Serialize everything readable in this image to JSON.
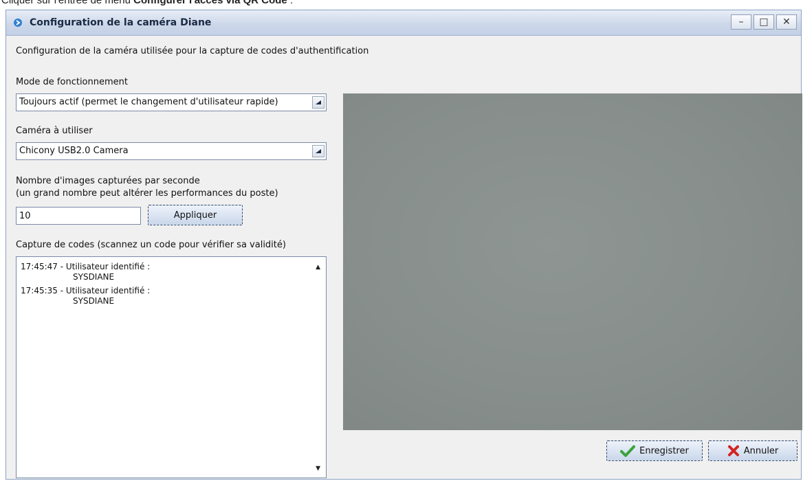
{
  "doc": {
    "line_prefix": "Cliquer sur l'entrée de menu ",
    "line_bold": "Configurer l'accès via QR Code",
    "line_suffix": " :"
  },
  "window": {
    "title": "Configuration de la caméra Diane",
    "controls": {
      "minimize": "–",
      "maximize": "□",
      "close": "✕"
    }
  },
  "description": "Configuration de la caméra utilisée pour la capture de codes d'authentification",
  "mode": {
    "label": "Mode de fonctionnement",
    "value": "Toujours actif (permet le changement d'utilisateur rapide)"
  },
  "camera_select": {
    "label": "Caméra à utiliser",
    "value": "Chicony USB2.0 Camera"
  },
  "fps": {
    "label_line1": "Nombre d'images capturées par seconde",
    "label_line2": "(un grand nombre peut altérer les performances du poste)",
    "value": "10",
    "apply_label": "Appliquer"
  },
  "capture": {
    "label": "Capture de codes (scannez un code pour vérifier sa validité)",
    "log": [
      {
        "time": "17:45:47",
        "message": "Utilisateur identifié :",
        "user": "SYSDIANE"
      },
      {
        "time": "17:45:35",
        "message": "Utilisateur identifié :",
        "user": "SYSDIANE"
      }
    ]
  },
  "buttons": {
    "save": "Enregistrer",
    "cancel": "Annuler"
  },
  "colors": {
    "titlebar": "#cdd8ea",
    "camera_feed": "#878e8c",
    "save_check": "#3aa33a",
    "cancel_x": "#d42323"
  }
}
